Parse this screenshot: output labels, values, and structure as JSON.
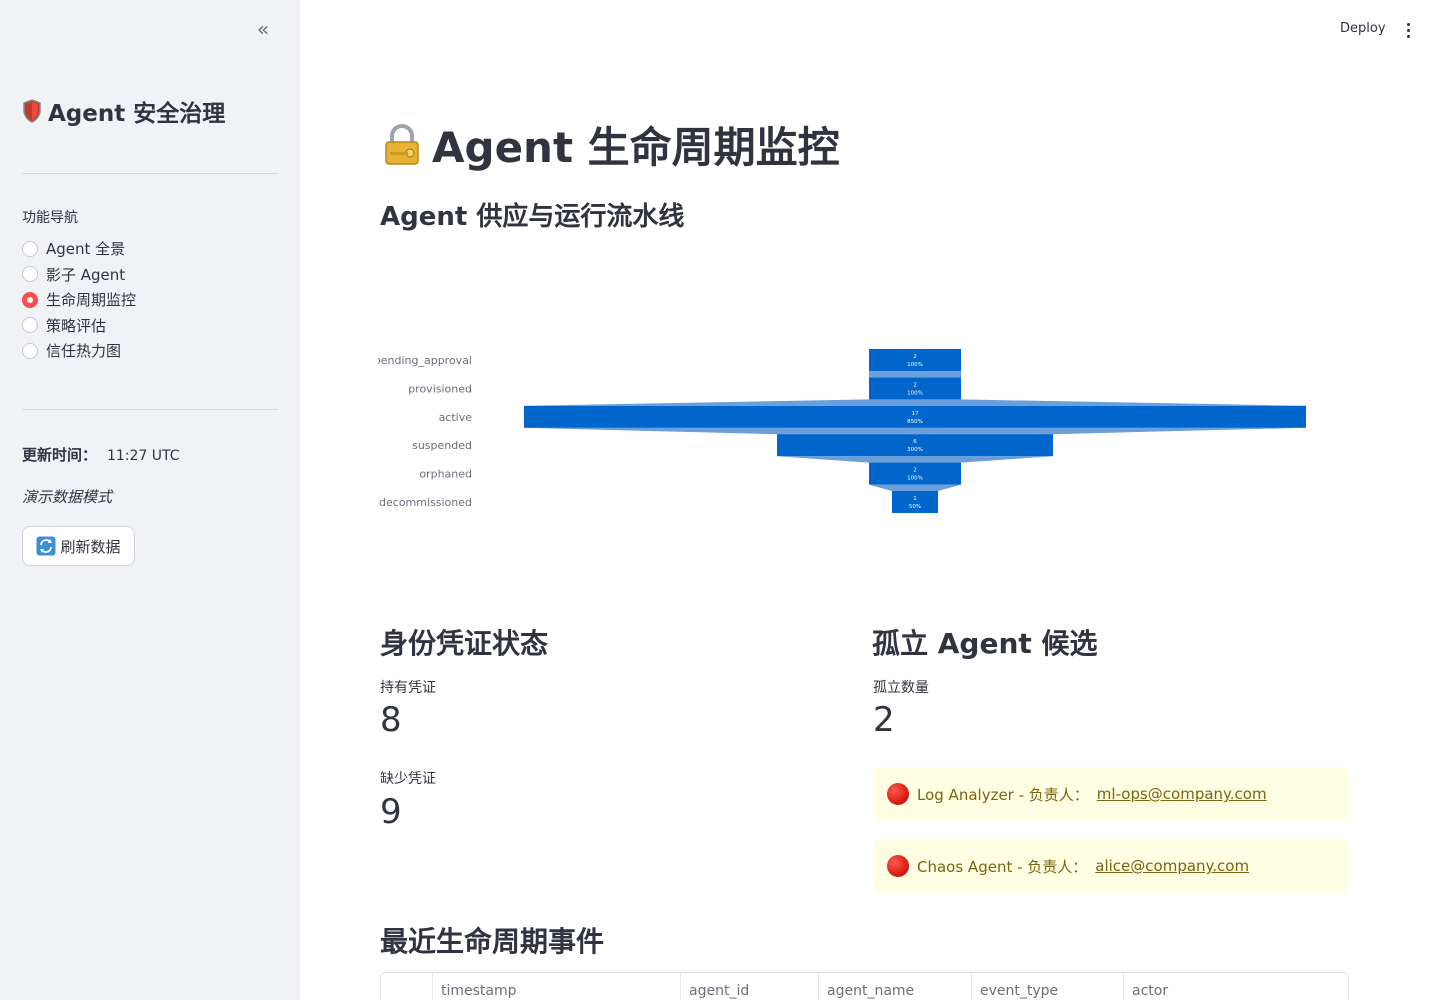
{
  "sidebar": {
    "title": "Agent 安全治理",
    "nav_label": "功能导航",
    "nav_items": [
      {
        "label": "Agent 全景",
        "selected": false
      },
      {
        "label": "影子 Agent",
        "selected": false
      },
      {
        "label": "生命周期监控",
        "selected": true
      },
      {
        "label": "策略评估",
        "selected": false
      },
      {
        "label": "信任热力图",
        "selected": false
      }
    ],
    "update_label": "更新时间：",
    "update_time": "11:27 UTC",
    "demo_mode": "演示数据模式",
    "refresh_label": "刷新数据"
  },
  "header": {
    "deploy_label": "Deploy"
  },
  "main": {
    "title": "Agent 生命周期监控",
    "pipeline_heading": "Agent 供应与运行流水线",
    "credentials": {
      "heading": "身份凭证状态",
      "has_label": "持有凭证",
      "has_value": "8",
      "missing_label": "缺少凭证",
      "missing_value": "9"
    },
    "orphans": {
      "heading": "孤立 Agent 候选",
      "count_label": "孤立数量",
      "count_value": "2",
      "items": [
        {
          "text": "Log Analyzer - 负责人：",
          "owner": "ml-ops@company.com"
        },
        {
          "text": "Chaos Agent - 负责人：",
          "owner": "alice@company.com"
        }
      ]
    },
    "events": {
      "heading": "最近生命周期事件",
      "columns": [
        "",
        "timestamp",
        "agent_id",
        "agent_name",
        "event_type",
        "actor"
      ]
    }
  },
  "chart_data": {
    "type": "funnel",
    "stages": [
      "pending_approval",
      "provisioned",
      "active",
      "suspended",
      "orphaned",
      "decommissioned"
    ],
    "values": [
      2,
      2,
      17,
      6,
      2,
      1
    ],
    "percent_labels": [
      "100%",
      "100%",
      "850%",
      "300%",
      "100%",
      "50%"
    ],
    "colors": {
      "bar": "#0066cc",
      "connector": "#6a9fdc"
    }
  }
}
